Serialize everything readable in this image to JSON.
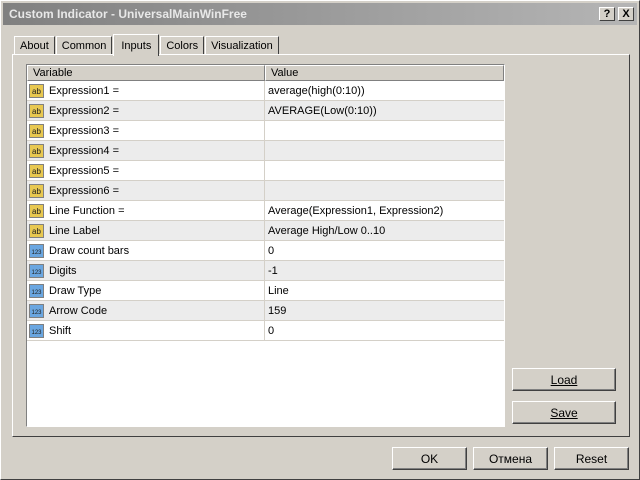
{
  "window": {
    "title": "Custom Indicator - UniversalMainWinFree",
    "help_label": "?",
    "close_label": "X"
  },
  "tabs": [
    {
      "label": "About"
    },
    {
      "label": "Common"
    },
    {
      "label": "Inputs"
    },
    {
      "label": "Colors"
    },
    {
      "label": "Visualization"
    }
  ],
  "active_tab": "Inputs",
  "table": {
    "headers": {
      "variable": "Variable",
      "value": "Value"
    },
    "rows": [
      {
        "variable": "Expression1 =",
        "value": "average(high(0:10))",
        "icon": "string-icon"
      },
      {
        "variable": "Expression2 =",
        "value": "AVERAGE(Low(0:10))",
        "icon": "string-icon"
      },
      {
        "variable": "Expression3 =",
        "value": "",
        "icon": "string-icon"
      },
      {
        "variable": "Expression4 =",
        "value": "",
        "icon": "string-icon"
      },
      {
        "variable": "Expression5 =",
        "value": "",
        "icon": "string-icon"
      },
      {
        "variable": "Expression6 =",
        "value": "",
        "icon": "string-icon"
      },
      {
        "variable": "Line Function =",
        "value": "Average(Expression1, Expression2)",
        "icon": "string-icon"
      },
      {
        "variable": "Line Label",
        "value": "Average High/Low 0..10",
        "icon": "string-icon"
      },
      {
        "variable": "Draw count bars",
        "value": "0",
        "icon": "integer-icon"
      },
      {
        "variable": "Digits",
        "value": "-1",
        "icon": "integer-icon"
      },
      {
        "variable": "Draw Type",
        "value": "Line",
        "icon": "integer-icon"
      },
      {
        "variable": "Arrow Code",
        "value": "159",
        "icon": "integer-icon"
      },
      {
        "variable": "Shift",
        "value": "0",
        "icon": "integer-icon"
      }
    ]
  },
  "icons": {
    "string_icon_text": "ab",
    "integer_icon_text": "123"
  },
  "buttons": {
    "load": "Load",
    "save": "Save",
    "ok": "OK",
    "cancel": "Отмена",
    "reset": "Reset"
  },
  "colors": {
    "title_bar_start": "#808080",
    "title_bar_end": "#b5b5b5",
    "face": "#d4d0c8",
    "string_icon": "#e8c850",
    "integer_icon": "#6aa6e0"
  }
}
